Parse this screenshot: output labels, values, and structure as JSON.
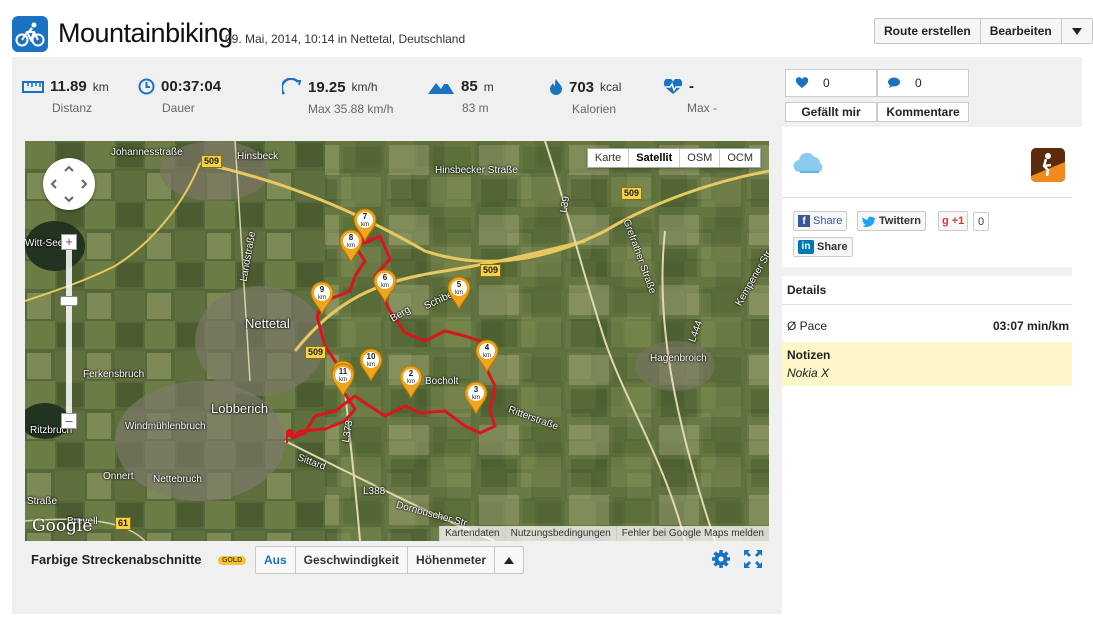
{
  "activity": {
    "title": "Mountainbiking",
    "subtitle": "09. Mai, 2014, 10:14 in Nettetal, Deutschland"
  },
  "header_buttons": {
    "create_route": "Route erstellen",
    "edit": "Bearbeiten"
  },
  "stats": [
    {
      "value": "11.89",
      "unit": "km",
      "label": "Distanz",
      "icon": "ruler-icon"
    },
    {
      "value": "00:37:04",
      "unit": "",
      "label": "Dauer",
      "icon": "clock-icon"
    },
    {
      "value": "19.25",
      "unit": "km/h",
      "label": "Max 35.88 km/h",
      "icon": "speed-icon"
    },
    {
      "value": "85",
      "unit": "m",
      "label": "83 m",
      "icon": "mountain-icon"
    },
    {
      "value": "703",
      "unit": "kcal",
      "label": "Kalorien",
      "icon": "flame-icon"
    },
    {
      "value": "-",
      "unit": "",
      "label": "Max -",
      "icon": "heartbeat-icon"
    }
  ],
  "social": {
    "likes_count": "0",
    "comments_count": "0",
    "like_label": "Gefällt mir",
    "comments_label": "Kommentare"
  },
  "map": {
    "types": [
      "Karte",
      "Satellit",
      "OSM",
      "OCM"
    ],
    "active_type": "Satellit",
    "footer": [
      "Kartendaten",
      "Nutzungsbedingungen",
      "Fehler bei Google Maps melden"
    ],
    "logo": "Google",
    "place_labels": [
      "Johannesstraße",
      "Hinsbeck",
      "Hinsbecker Straße",
      "Landstraße",
      "Nettetal",
      "Ferkensbruch",
      "Lobberich",
      "Windmühlenbruch",
      "Ritzbruch",
      "Onnert",
      "Nettebruch",
      "Sittard",
      "Hagenbroich",
      "Ritterstraße",
      "Bocholt",
      "Schibeck",
      "Berg",
      "L388",
      "Dornbuscher Str",
      "L373",
      "L39",
      "L444",
      "Grefrather Straße",
      "Kempener Str",
      "Straße",
      "Brevell",
      "Witt-See"
    ],
    "road_badges": [
      "509",
      "509",
      "509",
      "509",
      "61"
    ],
    "km_markers": [
      "1",
      "2",
      "3",
      "4",
      "5",
      "6",
      "7",
      "8",
      "9",
      "10",
      "11"
    ],
    "marker_unit": "km"
  },
  "segments": {
    "title": "Farbige Streckenabschnitte",
    "badge": "GOLD",
    "options": [
      "Aus",
      "Geschwindigkeit",
      "Höhenmeter"
    ],
    "selected": "Aus"
  },
  "share": {
    "facebook": "Share",
    "twitter": "Twittern",
    "gplus": "+1",
    "gplus_count": "0",
    "linkedin": "Share"
  },
  "details": {
    "header": "Details",
    "pace_label": "Ø Pace",
    "pace_value": "03:07 min/km",
    "notes_header": "Notizen",
    "notes_text": "Nokia X"
  },
  "colors": {
    "accent": "#1a73c0",
    "route": "#d8161c",
    "marker": "#f0a51c",
    "notes_bg": "#fcf6c9"
  }
}
